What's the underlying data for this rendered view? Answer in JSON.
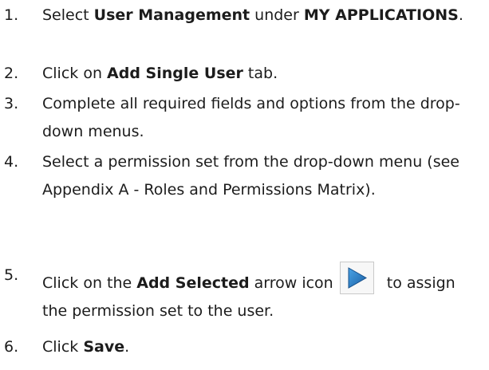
{
  "steps": [
    {
      "number": "1.",
      "parts": [
        {
          "text": "Select ",
          "bold": false
        },
        {
          "text": "User Management",
          "bold": true
        },
        {
          "text": " under ",
          "bold": false
        },
        {
          "text": "MY APPLICATIONS",
          "bold": true
        },
        {
          "text": ".",
          "bold": false
        }
      ]
    },
    {
      "number": "2.",
      "parts": [
        {
          "text": "Click on ",
          "bold": false
        },
        {
          "text": "Add Single User",
          "bold": true
        },
        {
          "text": " tab.",
          "bold": false
        }
      ]
    },
    {
      "number": "3.",
      "parts": [
        {
          "text": "Complete all required fields and options from the drop-down menus.",
          "bold": false
        }
      ]
    },
    {
      "number": "4.",
      "parts": [
        {
          "text": "Select a permission set from the drop-down menu (see Appendix A - Roles and Permissions Matrix).",
          "bold": false
        }
      ]
    },
    {
      "number": "5.",
      "parts": [
        {
          "text": "Click on the ",
          "bold": false
        },
        {
          "text": "Add Selected",
          "bold": true
        },
        {
          "text": " arrow icon ",
          "bold": false
        },
        {
          "icon": "play-arrow-icon"
        },
        {
          "text": "to assign the permission set to the user.",
          "bold": false
        }
      ]
    },
    {
      "number": "6.",
      "parts": [
        {
          "text": "Click ",
          "bold": false
        },
        {
          "text": "Save",
          "bold": true
        },
        {
          "text": ".",
          "bold": false
        }
      ]
    }
  ],
  "colors": {
    "text": "#1c1c1c",
    "arrow": "#1f6fb8"
  }
}
